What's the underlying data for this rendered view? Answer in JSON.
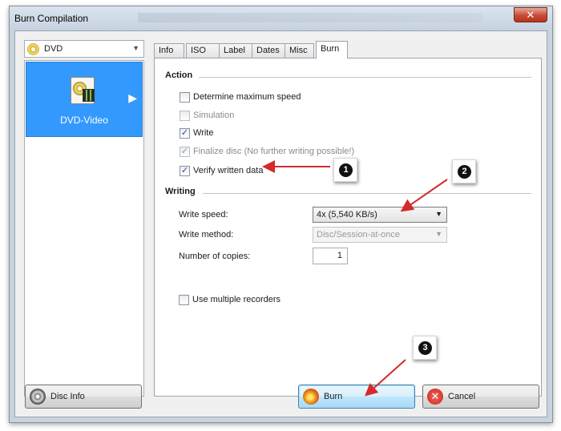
{
  "window": {
    "title": "Burn Compilation",
    "close_glyph": "✕"
  },
  "left": {
    "selector": {
      "value": "DVD",
      "icon": "dvd-disc-icon"
    },
    "items": [
      {
        "label": "DVD-Video",
        "icon": "dvd-video-icon",
        "selected": true
      }
    ]
  },
  "tabs": [
    {
      "label": "Info"
    },
    {
      "label": "ISO"
    },
    {
      "label": "Label"
    },
    {
      "label": "Dates"
    },
    {
      "label": "Misc"
    },
    {
      "label": "Burn",
      "active": true
    }
  ],
  "action": {
    "title": "Action",
    "options": [
      {
        "label": "Determine maximum speed",
        "checked": false,
        "enabled": true
      },
      {
        "label": "Simulation",
        "checked": false,
        "enabled": false
      },
      {
        "label": "Write",
        "checked": true,
        "enabled": true
      },
      {
        "label": "Finalize disc (No further writing possible!)",
        "checked": true,
        "enabled": false
      },
      {
        "label": "Verify written data",
        "checked": true,
        "enabled": true
      }
    ]
  },
  "writing": {
    "title": "Writing",
    "write_speed_label": "Write speed:",
    "write_speed_value": "4x (5,540 KB/s)",
    "write_method_label": "Write method:",
    "write_method_value": "Disc/Session-at-once",
    "copies_label": "Number of copies:",
    "copies_value": "1",
    "multiple_recorders_label": "Use multiple recorders"
  },
  "buttons": {
    "disc_info": "Disc Info",
    "burn": "Burn",
    "cancel": "Cancel"
  },
  "annotations": [
    {
      "number": "1"
    },
    {
      "number": "2"
    },
    {
      "number": "3"
    }
  ],
  "colors": {
    "selection": "#3399ff",
    "arrow": "#d42a2a",
    "accent": "#3c7fb1"
  }
}
